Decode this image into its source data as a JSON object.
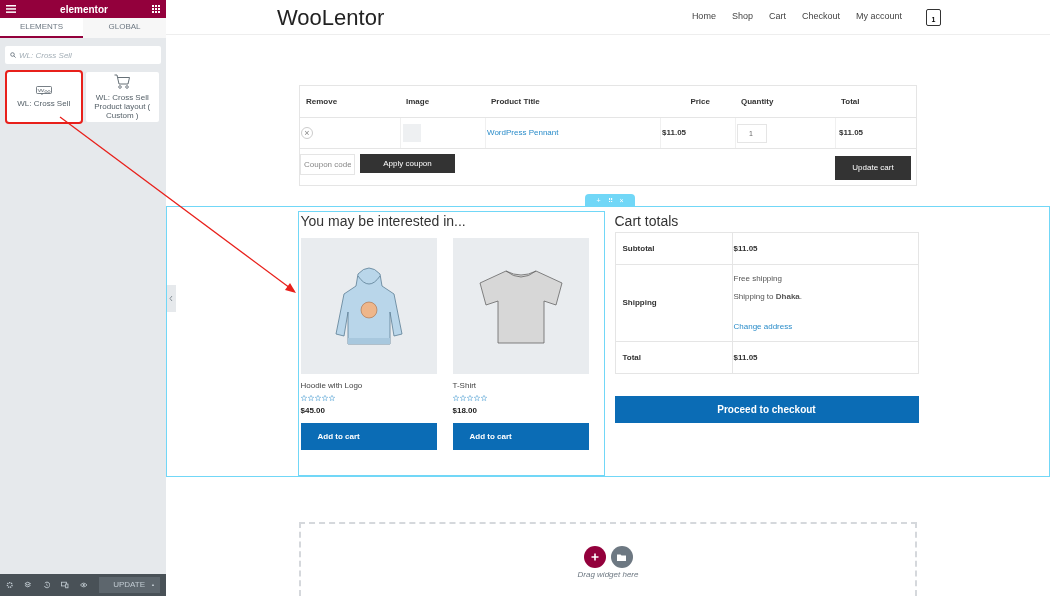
{
  "editor": {
    "brand": "elementor",
    "tabs": [
      {
        "label": "ELEMENTS",
        "selected": true
      },
      {
        "label": "GLOBAL",
        "selected": false
      }
    ],
    "search": {
      "value": "WL: Cross Sell"
    },
    "widgets": [
      {
        "kind": "woo",
        "label": "WL: Cross Sell",
        "selected": true
      },
      {
        "kind": "cart",
        "label": "WL: Cross Sell Product layout ( Custom )",
        "selected": false
      }
    ],
    "footer": {
      "update_button": "UPDATE",
      "caret": "▲"
    }
  },
  "site": {
    "logo": "WooLentor",
    "nav": [
      "Home",
      "Shop",
      "Cart",
      "Checkout",
      "My account"
    ],
    "cart_count": "1"
  },
  "cart_table": {
    "columns": [
      "Remove",
      "Image",
      "Product Title",
      "Price",
      "Quantity",
      "Total"
    ],
    "rows": [
      {
        "remove": "×",
        "product": "WordPress Pennant",
        "price": "$11.05",
        "quantity": "1",
        "total": "$11.05"
      }
    ],
    "coupon_placeholder": "Coupon code",
    "apply_button": "Apply coupon",
    "update_button": "Update cart"
  },
  "section_handle": [
    "+",
    "⠿",
    "×"
  ],
  "cross_sell": {
    "title": "You may be interested in...",
    "products": [
      {
        "kind": "hoodie",
        "name": "Hoodie with Logo",
        "stars": 0,
        "price": "$45.00",
        "button": "Add to cart"
      },
      {
        "kind": "tshirt",
        "name": "T-Shirt",
        "stars": 0,
        "price": "$18.00",
        "button": "Add to cart"
      }
    ]
  },
  "cart_totals": {
    "title": "Cart totals",
    "subtotal_label": "Subtotal",
    "subtotal": "$11.05",
    "shipping_label": "Shipping",
    "shipping_method": "Free shipping",
    "shipping_to": "Shipping to **Dhaka**.",
    "change_address": "Change address",
    "total_label": "Total",
    "total": "$11.05",
    "checkout_button": "Proceed to checkout"
  },
  "drop_zone": {
    "hint": "Drag widget here"
  }
}
